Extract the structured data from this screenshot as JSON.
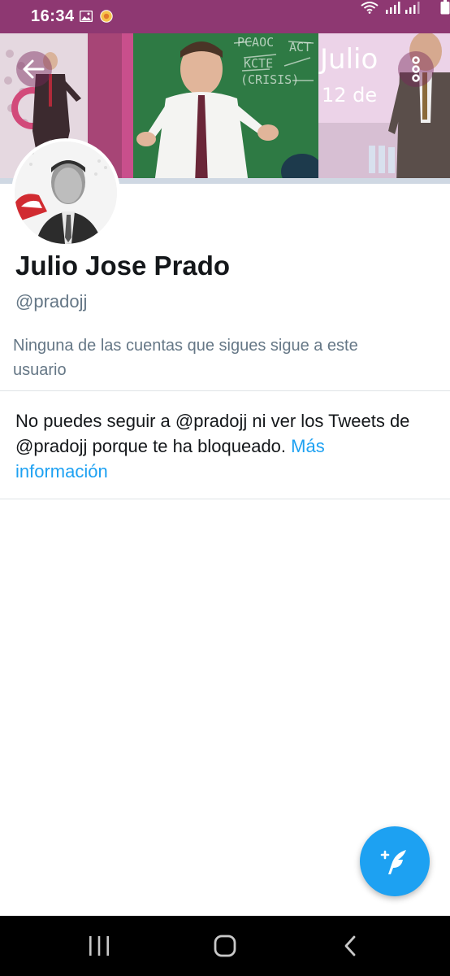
{
  "status_bar": {
    "time": "16:34",
    "background": "#8e3872",
    "icons": [
      "gallery-icon",
      "app-notification-icon",
      "wifi-icon",
      "signal-icon",
      "signal-icon",
      "battery-icon"
    ]
  },
  "banner": {
    "caption_big": "Julio",
    "caption_small": "12 de",
    "chalk_text": [
      "PCAOC",
      "KCTE",
      "(CRISIS)",
      "ACT"
    ],
    "back_icon": "arrow-left-icon",
    "more_icon": "more-vertical-icon"
  },
  "profile": {
    "name": "Julio Jose Prado",
    "handle": "@pradojj",
    "followers_note": "Ninguna de las cuentas que sigues sigue a este usuario"
  },
  "blocked": {
    "message": "No puedes seguir a @pradojj ni ver los Tweets de @pradojj porque te ha bloqueado.",
    "link_text": "Más información",
    "link_color": "#1da1f2"
  },
  "fab": {
    "icon": "compose-tweet-icon",
    "color": "#1da1f2"
  },
  "nav_bar": {
    "icons": [
      "recent-apps-icon",
      "home-icon",
      "back-icon"
    ]
  }
}
